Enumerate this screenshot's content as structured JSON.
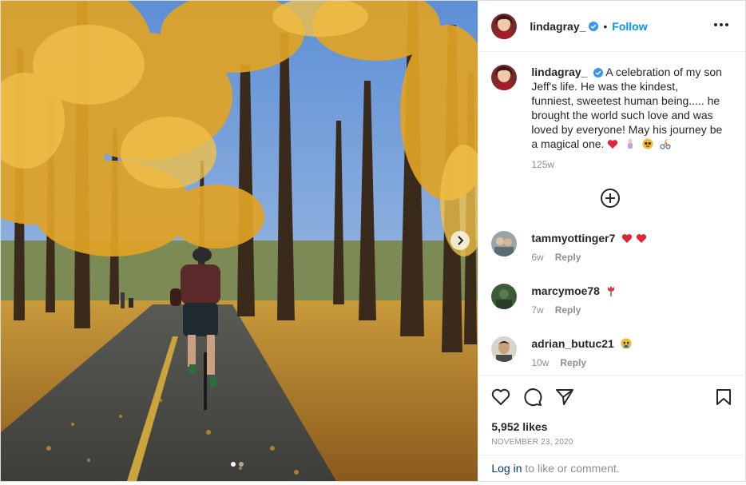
{
  "post": {
    "author": "lindagray_",
    "follow_label": "Follow",
    "separator": "•",
    "caption": "A celebration of my son Jeff's life. He was the kindest, funniest, sweetest human being..... he brought the world such love and was loved by everyone! May his journey be a magical one.",
    "caption_emojis": [
      "red-heart-icon",
      "person-in-bed-icon",
      "pleading-face-icon",
      "person-biking-icon"
    ],
    "caption_age": "125w",
    "likes": "5,952 likes",
    "date": "NOVEMBER 23, 2020",
    "photo_count": 2,
    "active_photo": 1
  },
  "comments": [
    {
      "user": "tammyottinger7",
      "age": "6w",
      "reply": "Reply",
      "emojis": [
        "red-heart-icon",
        "red-heart-icon"
      ]
    },
    {
      "user": "marcymoe78",
      "age": "7w",
      "reply": "Reply",
      "emojis": [
        "tulip-icon"
      ]
    },
    {
      "user": "adrian_butuc21",
      "age": "10w",
      "reply": "Reply",
      "emojis": [
        "crying-face-icon"
      ]
    }
  ],
  "login": {
    "link": "Log in",
    "rest": " to like or comment."
  },
  "colors": {
    "accent": "#0095f6",
    "verified": "#3897f0",
    "heart": "#e0243a"
  }
}
